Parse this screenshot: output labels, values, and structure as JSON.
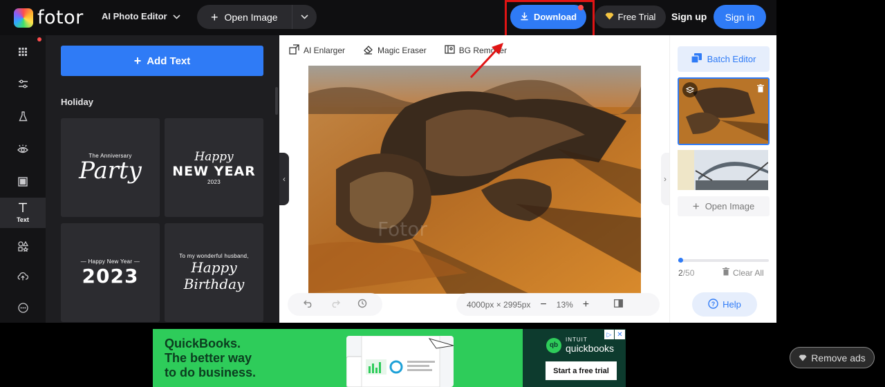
{
  "topbar": {
    "logo_text": "fotor",
    "editor_menu_label": "AI Photo Editor",
    "open_image_label": "Open Image",
    "download_label": "Download",
    "free_trial_label": "Free Trial",
    "signup_label": "Sign up",
    "signin_label": "Sign in"
  },
  "rail": {
    "items": [
      {
        "icon": "grid-icon"
      },
      {
        "icon": "sliders-icon"
      },
      {
        "icon": "flask-icon"
      },
      {
        "icon": "eye-icon"
      },
      {
        "icon": "frame-icon"
      },
      {
        "icon": "text-icon",
        "label": "Text",
        "active": true
      },
      {
        "icon": "elements-icon"
      },
      {
        "icon": "cloud-upload-icon"
      },
      {
        "icon": "more-icon"
      }
    ]
  },
  "panel": {
    "add_text_label": "Add Text",
    "section_title": "Holiday",
    "templates": [
      {
        "line1": "The Anniversary",
        "line2": "Party"
      },
      {
        "line1": "Happy",
        "line2": "NEW YEAR",
        "line3": "2023"
      },
      {
        "line1": "— Happy New Year —",
        "line2": "2023"
      },
      {
        "line1": "To my wonderful husband,",
        "line2": "Happy Birthday"
      }
    ]
  },
  "canvas": {
    "tools": [
      {
        "icon": "ai-enlarger-icon",
        "label": "AI Enlarger"
      },
      {
        "icon": "magic-eraser-icon",
        "label": "Magic Eraser"
      },
      {
        "icon": "bg-remover-icon",
        "label": "BG Remover"
      }
    ],
    "watermark": "Fotor",
    "dimensions": "4000px × 2995px",
    "zoom": "13%"
  },
  "right_panel": {
    "batch_editor_label": "Batch Editor",
    "open_image_label": "Open Image",
    "count_current": "2",
    "count_total": "/50",
    "progress": 0.04,
    "clear_all_label": "Clear All",
    "help_label": "Help"
  },
  "ad": {
    "headline_1": "QuickBooks.",
    "headline_2": "The better way",
    "headline_3": "to do business.",
    "brand_top": "INTUIT",
    "brand_name": "quickbooks",
    "cta_label": "Start a free trial"
  },
  "remove_ads_label": "Remove ads",
  "colors": {
    "accent": "#2f7bf6",
    "highlight": "#e01414",
    "ad_green": "#2ecc5a"
  }
}
